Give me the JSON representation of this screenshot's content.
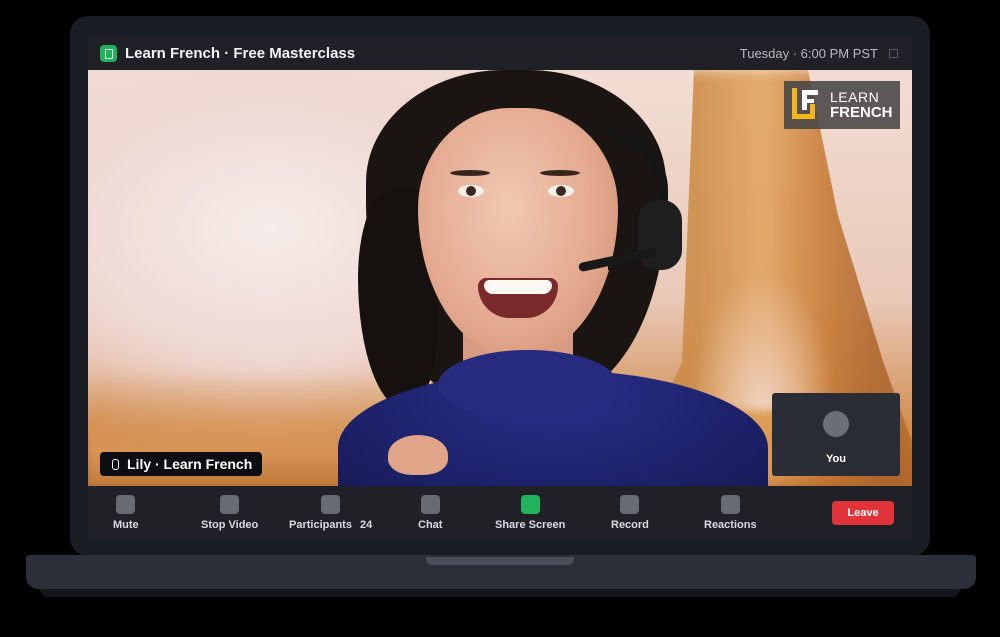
{
  "window": {
    "title": "Learn French · Free Masterclass",
    "datetime": "Tuesday · 6:00 PM PST",
    "app_icon": "meeting-app-icon"
  },
  "video": {
    "presenter_label": "Lily · Learn French",
    "logo_line1": "LEARN",
    "logo_line2": "FRENCH",
    "self_view_label": "You"
  },
  "controls": {
    "mute": "Mute",
    "stop_video": "Stop Video",
    "participants": "Participants",
    "participants_count": "24",
    "chat": "Chat",
    "share_screen": "Share Screen",
    "record": "Record",
    "reactions": "Reactions",
    "leave": "Leave"
  },
  "colors": {
    "accent_green": "#21b35b",
    "leave_red": "#e0333a",
    "logo_yellow": "#f2b51c"
  }
}
